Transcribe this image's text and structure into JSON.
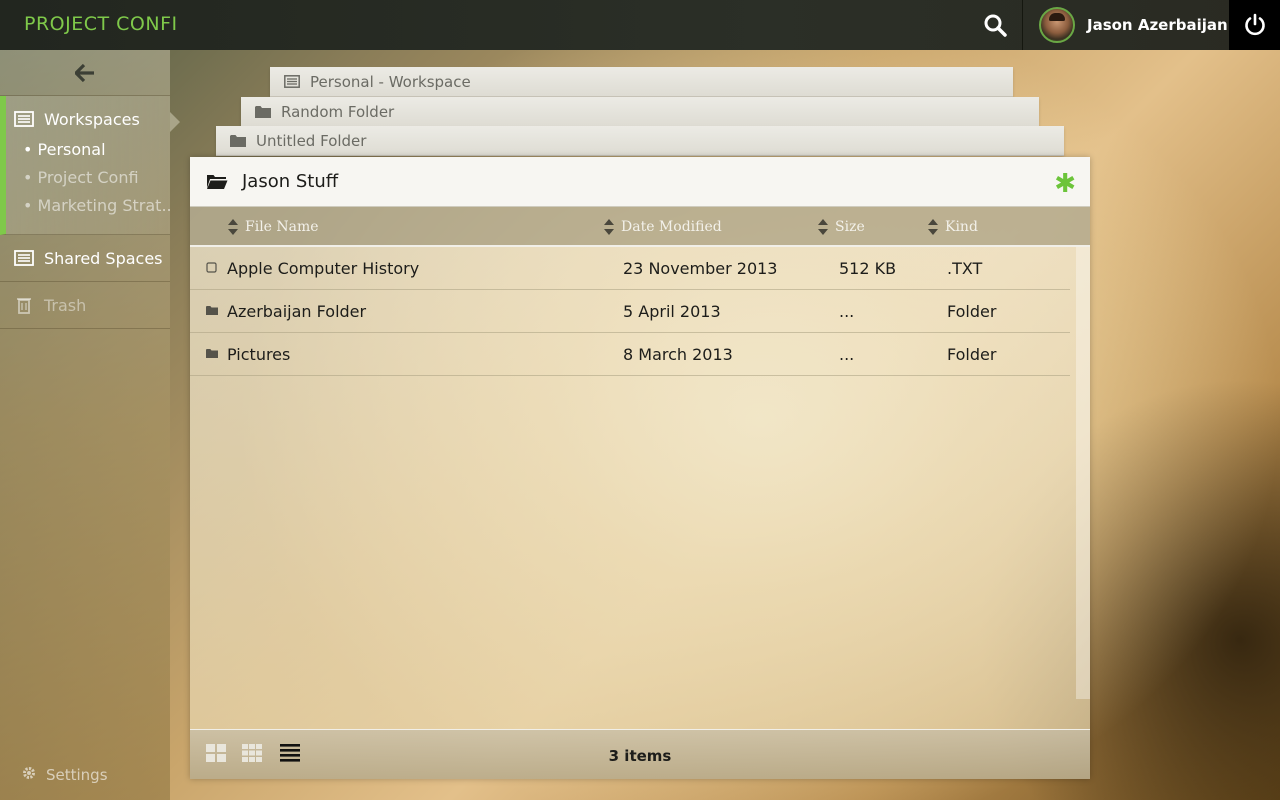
{
  "app": {
    "brand": "PROJECT CONFI"
  },
  "topbar": {
    "user_name": "Jason Azerbaijan"
  },
  "sidebar": {
    "workspaces_label": "Workspaces",
    "workspace_items": [
      {
        "label": "• Personal",
        "state": "current"
      },
      {
        "label": "• Project Confi",
        "state": "dim"
      },
      {
        "label": "• Marketing Strat...",
        "state": "dim"
      }
    ],
    "shared_label": "Shared Spaces",
    "trash_label": "Trash",
    "settings_label": "Settings"
  },
  "stack_tabs": [
    {
      "label": "Personal - Workspace",
      "icon": "list-icon"
    },
    {
      "label": "Random Folder",
      "icon": "folder-icon"
    },
    {
      "label": "Untitled Folder",
      "icon": "folder-icon"
    }
  ],
  "panel": {
    "title": "Jason Stuff",
    "action_glyph": "✱",
    "columns": {
      "name": "File Name",
      "date": "Date Modified",
      "size": "Size",
      "kind": "Kind"
    },
    "rows": [
      {
        "name": "Apple Computer History",
        "date": "23 November 2013",
        "size": "512 KB",
        "kind": ".TXT",
        "icon": "file-icon"
      },
      {
        "name": "Azerbaijan Folder",
        "date": "5 April 2013",
        "size": "...",
        "kind": "Folder",
        "icon": "folder-icon"
      },
      {
        "name": "Pictures",
        "date": "8 March 2013",
        "size": "...",
        "kind": "Folder",
        "icon": "folder-icon"
      }
    ],
    "footer": {
      "count": "3 items"
    }
  },
  "colors": {
    "accent": "#7fc94a",
    "topbar": "#2b2f27"
  }
}
